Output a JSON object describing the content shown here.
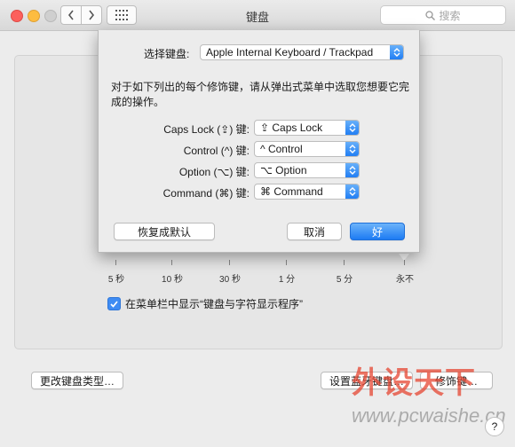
{
  "window": {
    "title": "键盘"
  },
  "toolbar": {
    "search_placeholder": "搜索"
  },
  "sheet": {
    "keyboard_label": "选择键盘:",
    "keyboard_value": "Apple Internal Keyboard / Trackpad",
    "description": "对于如下列出的每个修饰键，请从弹出式菜单中选取您想要它完成的操作。",
    "modifiers": [
      {
        "label": "Caps Lock (⇪) 键:",
        "value": "⇪ Caps Lock"
      },
      {
        "label": "Control (^) 键:",
        "value": "^ Control"
      },
      {
        "label": "Option (⌥) 键:",
        "value": "⌥ Option"
      },
      {
        "label": "Command (⌘) 键:",
        "value": "⌘ Command"
      }
    ],
    "restore_label": "恢复成默认",
    "cancel_label": "取消",
    "ok_label": "好"
  },
  "pane": {
    "slider_labels": [
      "5 秒",
      "10 秒",
      "30 秒",
      "1 分",
      "5 分",
      "永不"
    ],
    "show_menu_checkbox": {
      "label": "在菜单栏中显示“键盘与字符显示程序”",
      "checked": true
    },
    "change_type_label": "更改键盘类型…",
    "bluetooth_label": "设置蓝牙键盘…",
    "modifier_keys_label": "修饰键…"
  },
  "watermark": {
    "logo": "外设天下",
    "url": "www.pcwaishe.cn"
  },
  "colors": {
    "accent": "#1d7bf3",
    "close": "#fc605c",
    "minimize": "#fdbc40"
  }
}
